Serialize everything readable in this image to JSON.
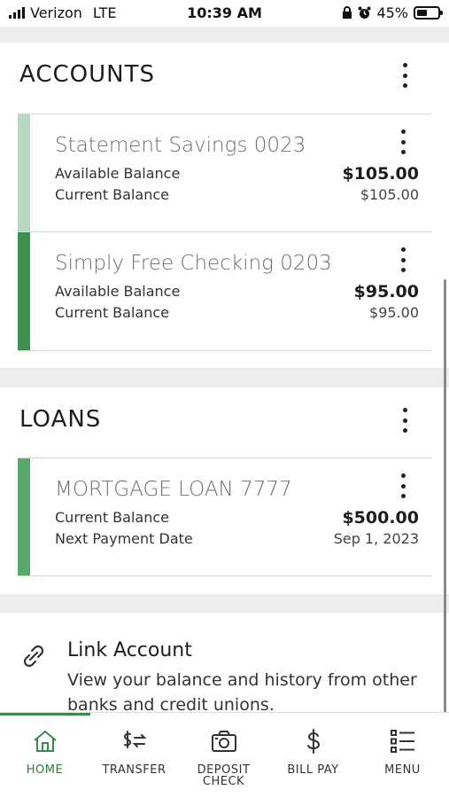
{
  "status": {
    "carrier": "Verizon",
    "network": "LTE",
    "time": "10:39 AM",
    "battery": "45%",
    "battery_level": 0.45
  },
  "accounts": {
    "title": "ACCOUNTS",
    "items": [
      {
        "name": "Statement Savings 0023",
        "label1": "Available Balance",
        "value1": "$105.00",
        "label2": "Current Balance",
        "value2": "$105.00",
        "color": "#b9d8c0"
      },
      {
        "name": "Simply Free Checking 0203",
        "label1": "Available Balance",
        "value1": "$95.00",
        "label2": "Current Balance",
        "value2": "$95.00",
        "color": "#3f8f4f"
      }
    ]
  },
  "loans": {
    "title": "LOANS",
    "items": [
      {
        "name": "MORTGAGE LOAN 7777",
        "label1": "Current Balance",
        "value1": "$500.00",
        "label2": "Next Payment Date",
        "value2": "Sep 1, 2023",
        "color": "#5aa86b"
      }
    ]
  },
  "link_account": {
    "title": "Link Account",
    "description": "View your balance and history from other banks and credit unions."
  },
  "tabs": [
    {
      "label": "HOME",
      "icon": "home-icon",
      "active": true
    },
    {
      "label": "TRANSFER",
      "icon": "transfer-icon"
    },
    {
      "label": "DEPOSIT CHECK",
      "icon": "camera-icon"
    },
    {
      "label": "BILL PAY",
      "icon": "dollar-icon"
    },
    {
      "label": "MENU",
      "icon": "menu-icon"
    }
  ],
  "colors": {
    "accent": "#3a8a4e",
    "active_tab": "#2f7d3f"
  }
}
